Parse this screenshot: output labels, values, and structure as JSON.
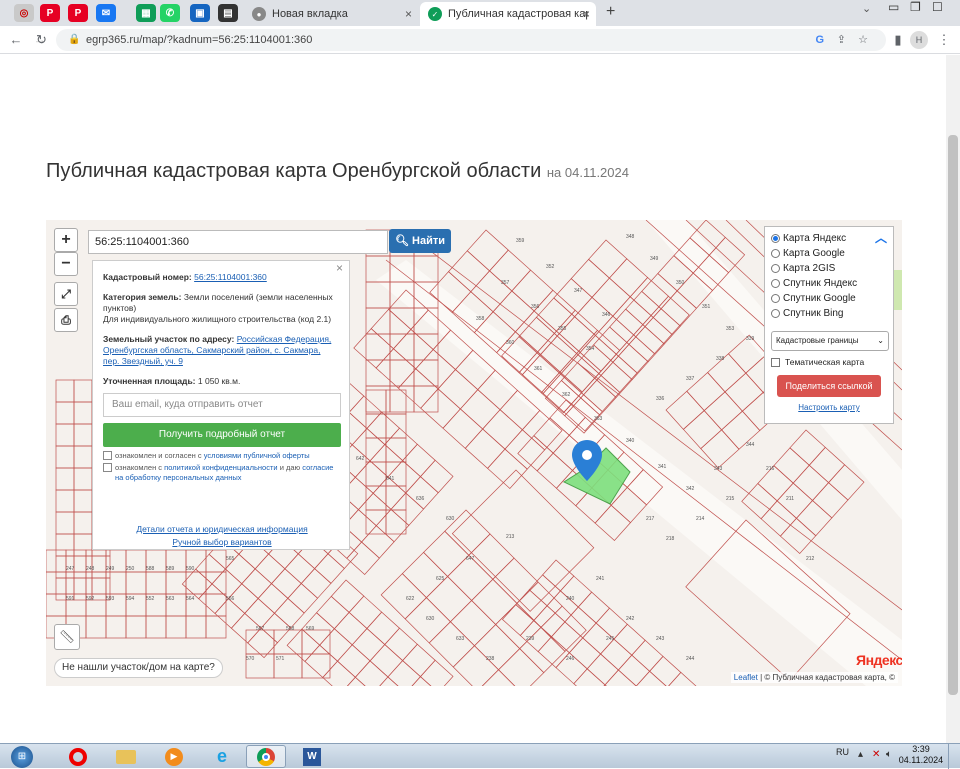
{
  "browser": {
    "tabs": [
      {
        "label": "Новая вкладка"
      },
      {
        "label": "Публичная кадастровая карта О"
      }
    ],
    "address": "egrp365.ru/map/?kadnum=56:25:1104001:360",
    "profile_initial": "H"
  },
  "page": {
    "title": "Публичная кадастровая карта Оренбургской области",
    "date_prefix": "на",
    "date": "04.11.2024"
  },
  "map": {
    "zoom_in": "+",
    "zoom_out": "−",
    "search_value": "56:25:1104001:360",
    "search_button": "Найти",
    "not_found_label": "Не нашли участок/дом на карте?",
    "brand": "Яндекс",
    "attribution_leaflet": "Leaflet",
    "attribution_text": "| © Публичная кадастровая карта, ©",
    "parcel_numbers": [
      "359",
      "352",
      "347",
      "346",
      "348",
      "349",
      "350",
      "351",
      "353",
      "354",
      "355",
      "356",
      "357",
      "358",
      "360",
      "361",
      "362",
      "363",
      "340",
      "341",
      "342",
      "343",
      "344",
      "345",
      "336",
      "337",
      "338",
      "339",
      "217",
      "218",
      "214",
      "215",
      "216",
      "211",
      "212",
      "213",
      "647",
      "625",
      "622",
      "630",
      "636",
      "641",
      "642",
      "643",
      "630",
      "633",
      "238",
      "239",
      "240",
      "241",
      "242",
      "243",
      "244",
      "245",
      "246",
      "247",
      "248",
      "249",
      "250",
      "588",
      "589",
      "590",
      "591",
      "592",
      "593",
      "594",
      "552",
      "563",
      "564",
      "565",
      "566",
      "567",
      "568",
      "569",
      "570",
      "571"
    ]
  },
  "info_popup": {
    "cadastral_label": "Кадастровый номер:",
    "cadastral_value": "56:25:1104001:360",
    "category_label": "Категория земель:",
    "category_value": "Земли поселений (земли населенных пунктов)",
    "usage_value": "Для индивидуального жилищного строительства (код 2.1)",
    "address_label": "Земельный участок по адресу:",
    "address_value": "Российская Федерация, Оренбургская область, Сакмарский район, с. Сакмара, пер. Звездный, уч. 9",
    "area_label": "Уточненная площадь:",
    "area_value": "1 050 кв.м.",
    "email_placeholder": "Ваш email, куда отправить отчет",
    "report_button": "Получить подробный отчет",
    "consent1_prefix": "ознакомлен и согласен с",
    "consent1_link": "условиями публичной оферты",
    "consent2_prefix": "ознакомлен с",
    "consent2_link": "политикой конфиденциальности",
    "consent2_mid": "и даю",
    "consent2_link2": "согласие на обработку персональных данных",
    "details_link": "Детали отчета и юридическая информация",
    "manual_link": "Ручной выбор вариантов"
  },
  "layers": {
    "options": [
      {
        "label": "Карта Яндекс",
        "selected": true
      },
      {
        "label": "Карта Google",
        "selected": false
      },
      {
        "label": "Карта 2GIS",
        "selected": false
      },
      {
        "label": "Спутник Яндекс",
        "selected": false
      },
      {
        "label": "Спутник Google",
        "selected": false
      },
      {
        "label": "Спутник Bing",
        "selected": false
      }
    ],
    "boundaries_select": "Кадастровые границы",
    "thematic_label": "Тематическая карта",
    "share_button": "Поделиться ссылкой",
    "configure_link": "Настроить карту"
  },
  "taskbar": {
    "lang": "RU",
    "time": "3:39",
    "date": "04.11.2024"
  },
  "colors": {
    "accent_blue": "#2a6fb0",
    "green_button": "#4cae4c",
    "red_button": "#d9534f",
    "parcel_line": "#c0504d",
    "selected_parcel": "#7ee07e",
    "marker": "#2a7fd6"
  }
}
